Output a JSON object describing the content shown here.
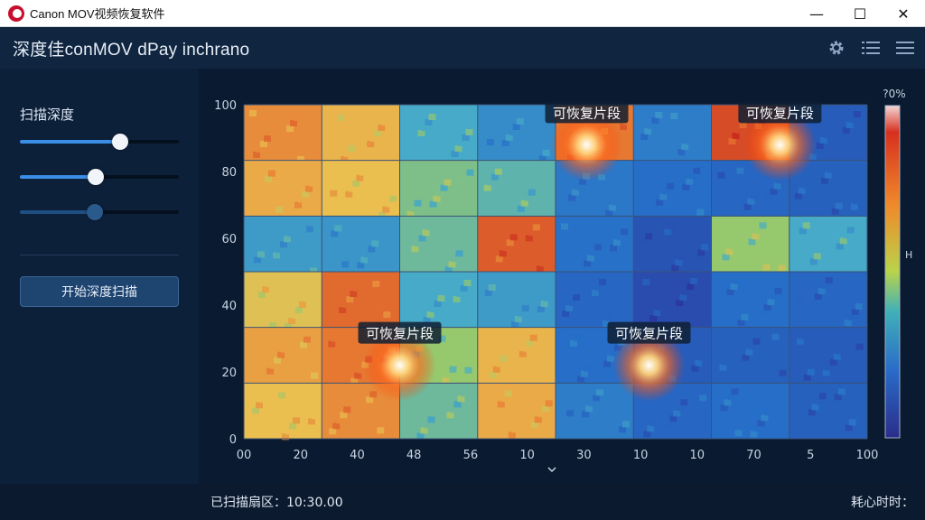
{
  "window": {
    "title": "Canon MOV视频恢复软件",
    "minimize_glyph": "—",
    "maximize_glyph": "☐",
    "close_glyph": "✕"
  },
  "header": {
    "title": "深度佳conMOV dPay inchrano",
    "icons": [
      "gear-icon",
      "list-icon",
      "menu-icon"
    ]
  },
  "left_panel": {
    "label": "扫描深度",
    "sliders": [
      0.63,
      0.48,
      0.47
    ],
    "scan_button": "开始深度扫描"
  },
  "status": {
    "scanned_label": "已扫描扇区：",
    "scanned_value": "10:30.00",
    "elapsed_label": "耗心时时："
  },
  "colors": {
    "accent": "#3b8ee6",
    "hot": "#d7301f",
    "cold": "#2b3a9a"
  },
  "chart_data": {
    "type": "heatmap",
    "x_tick_labels": [
      "00",
      "20",
      "40",
      "48",
      "56",
      "10",
      "30",
      "10",
      "10",
      "70",
      "5",
      "100"
    ],
    "y_tick_labels": [
      "100",
      "80",
      "60",
      "40",
      "20",
      "0"
    ],
    "colorbar_top_label": "?0%",
    "colorbar_mid_label": "H",
    "rows": 6,
    "cols": 8,
    "cells": [
      [
        0.78,
        0.7,
        0.45,
        0.35,
        0.82,
        0.3,
        0.92,
        0.18
      ],
      [
        0.72,
        0.68,
        0.52,
        0.48,
        0.28,
        0.25,
        0.22,
        0.2
      ],
      [
        0.4,
        0.38,
        0.5,
        0.88,
        0.26,
        0.15,
        0.55,
        0.45
      ],
      [
        0.66,
        0.85,
        0.45,
        0.4,
        0.22,
        0.12,
        0.25,
        0.22
      ],
      [
        0.74,
        0.82,
        0.55,
        0.7,
        0.25,
        0.18,
        0.2,
        0.18
      ],
      [
        0.68,
        0.78,
        0.5,
        0.72,
        0.3,
        0.22,
        0.25,
        0.2
      ]
    ],
    "hotspots": [
      {
        "x": 55,
        "y": 88,
        "label": "可恢复片段"
      },
      {
        "x": 86,
        "y": 88,
        "label": "可恢复片段"
      },
      {
        "x": 25,
        "y": 22,
        "label": "可恢复片段"
      },
      {
        "x": 65,
        "y": 22,
        "label": "可恢复片段"
      }
    ],
    "xlim": [
      0,
      100
    ],
    "ylim": [
      0,
      100
    ]
  }
}
